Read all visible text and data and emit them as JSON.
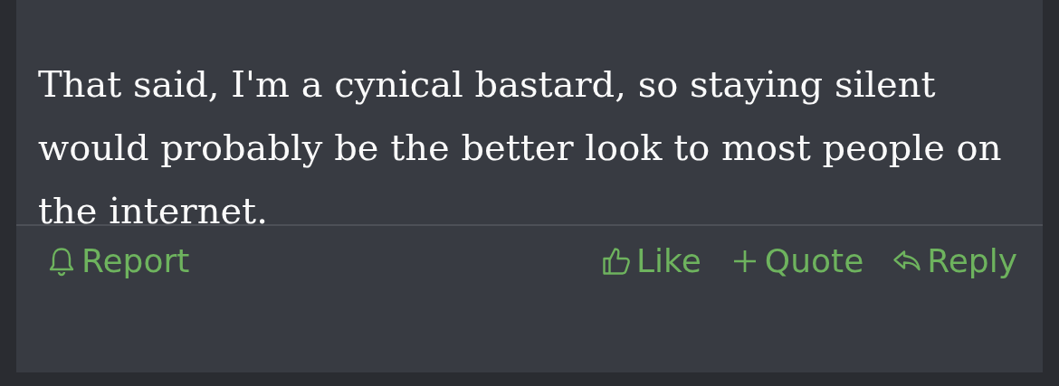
{
  "post": {
    "text": "That said, I'm a cynical bastard, so staying silent would probably be the better look to most people on the internet."
  },
  "left_actions": [
    {
      "kind": "report",
      "label": "Report"
    }
  ],
  "right_actions": [
    {
      "kind": "like",
      "label": "Like"
    },
    {
      "kind": "quote",
      "label": "Quote"
    },
    {
      "kind": "reply",
      "label": "Reply"
    }
  ]
}
